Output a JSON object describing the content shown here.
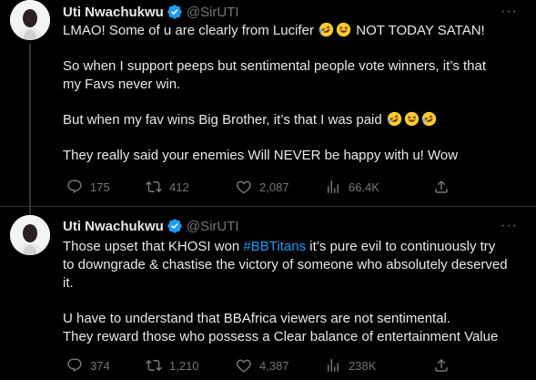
{
  "tweets": [
    {
      "display_name": "Uti Nwachukwu",
      "handle": "@SirUTI",
      "lines": [
        [
          "LMAO! Some of u are clearly from Lucifer ",
          "🤣😆",
          " NOT TODAY SATAN!"
        ],
        "So when I support peeps but sentimental people vote winners, it’s that",
        "my Favs never win.",
        [
          "But when my fav wins Big Brother, it’s that I was paid ",
          "🤣😆🤣"
        ],
        "They really said your enemies Will NEVER be happy with u! Wow"
      ],
      "line_1a": "LMAO! Some of u are clearly from Lucifer",
      "line_1b": "NOT TODAY SATAN!",
      "line_2": "So when I support peeps but sentimental people vote winners, it’s that",
      "line_3": "my Favs never win.",
      "line_4": "But when my fav wins Big Brother, it’s that I was paid",
      "line_5": "They really said your enemies Will NEVER be happy with u! Wow",
      "replies": "175",
      "retweets": "412",
      "likes": "2,087",
      "views": "66.4K"
    },
    {
      "display_name": "Uti Nwachukwu",
      "handle": "@SirUTI",
      "line_1a": "Those upset that KHOSI won",
      "hashtag": "#BBTitans",
      "line_1b": "it’s pure evil to continuously try",
      "line_2": "to downgrade & chastise the victory of someone who absolutely deserved",
      "line_3": "it.",
      "line_4": "U have to understand that BBAfrica viewers are not sentimental.",
      "line_5": "They reward those who possess a Clear balance of entertainment Value",
      "replies": "374",
      "retweets": "1,210",
      "likes": "4,387",
      "views": "238K"
    }
  ],
  "more_label": "···",
  "emojis": {
    "rofl": "rolling-on-floor-laughing",
    "grin": "grinning-squinting"
  },
  "colors": {
    "background": "#000000",
    "text": "#e7e9ea",
    "muted": "#71767b",
    "link": "#1d9bf0",
    "verified": "#1d9bf0",
    "divider": "#2f3336"
  }
}
